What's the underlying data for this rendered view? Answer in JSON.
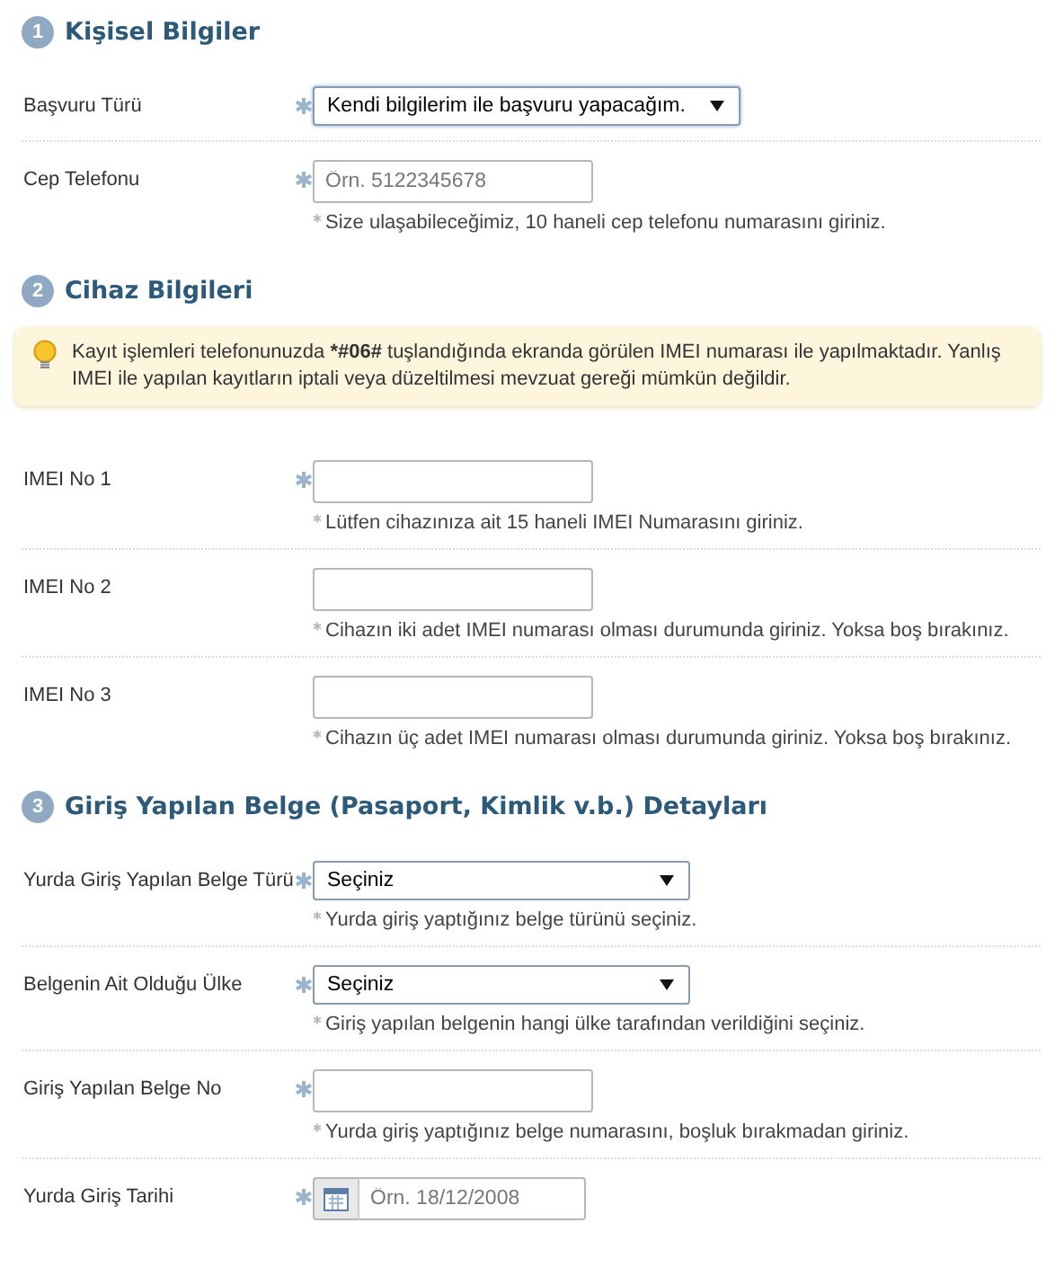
{
  "sections": [
    {
      "number": "1",
      "title": "Kişisel Bilgiler",
      "fields": [
        {
          "label": "Başvuru Türü",
          "required": true,
          "kind": "select",
          "value": "Kendi bilgilerim ile başvuru yapacağım."
        },
        {
          "label": "Cep Telefonu",
          "required": true,
          "kind": "text",
          "placeholder": "Örn. 5122345678",
          "hint": "Size ulaşabileceğimiz, 10 haneli cep telefonu numarasını giriniz."
        }
      ]
    },
    {
      "number": "2",
      "title": "Cihaz Bilgileri",
      "notice": [
        {
          "text": "Kayıt işlemleri telefonunuzda ",
          "bold": false
        },
        {
          "text": "*#06#",
          "bold": true
        },
        {
          "text": " tuşlandığında ekranda görülen IMEI numarası ile yapılmaktadır. Yanlış IMEI ile yapılan kayıtların iptali veya düzeltilmesi mevzuat gereği mümkün değildir.",
          "bold": false
        }
      ],
      "fields": [
        {
          "label": "IMEI No 1",
          "required": true,
          "kind": "text",
          "hint": "Lütfen cihazınıza ait 15 haneli IMEI Numarasını giriniz."
        },
        {
          "label": "IMEI No 2",
          "required": false,
          "kind": "text",
          "hint": "Cihazın iki adet IMEI numarası olması durumunda giriniz. Yoksa boş bırakınız."
        },
        {
          "label": "IMEI No 3",
          "required": false,
          "kind": "text",
          "hint": "Cihazın üç adet IMEI numarası olması durumunda giriniz. Yoksa boş bırakınız."
        }
      ]
    },
    {
      "number": "3",
      "title": "Giriş Yapılan Belge (Pasaport, Kimlik v.b.) Detayları",
      "fields": [
        {
          "label": "Yurda Giriş Yapılan Belge Türü",
          "required": true,
          "kind": "select",
          "value": "Seçiniz",
          "hint": "Yurda giriş yaptığınız belge türünü seçiniz."
        },
        {
          "label": "Belgenin Ait Olduğu Ülke",
          "required": true,
          "kind": "select",
          "value": "Seçiniz",
          "hint": "Giriş yapılan belgenin hangi ülke tarafından verildiğini seçiniz."
        },
        {
          "label": "Giriş Yapılan Belge No",
          "required": true,
          "kind": "text",
          "hint": "Yurda giriş yaptığınız belge numarasını, boşluk bırakmadan giriniz."
        },
        {
          "label": "Yurda Giriş Tarihi",
          "required": true,
          "kind": "date",
          "placeholder": "Örn. 18/12/2008"
        }
      ]
    }
  ]
}
